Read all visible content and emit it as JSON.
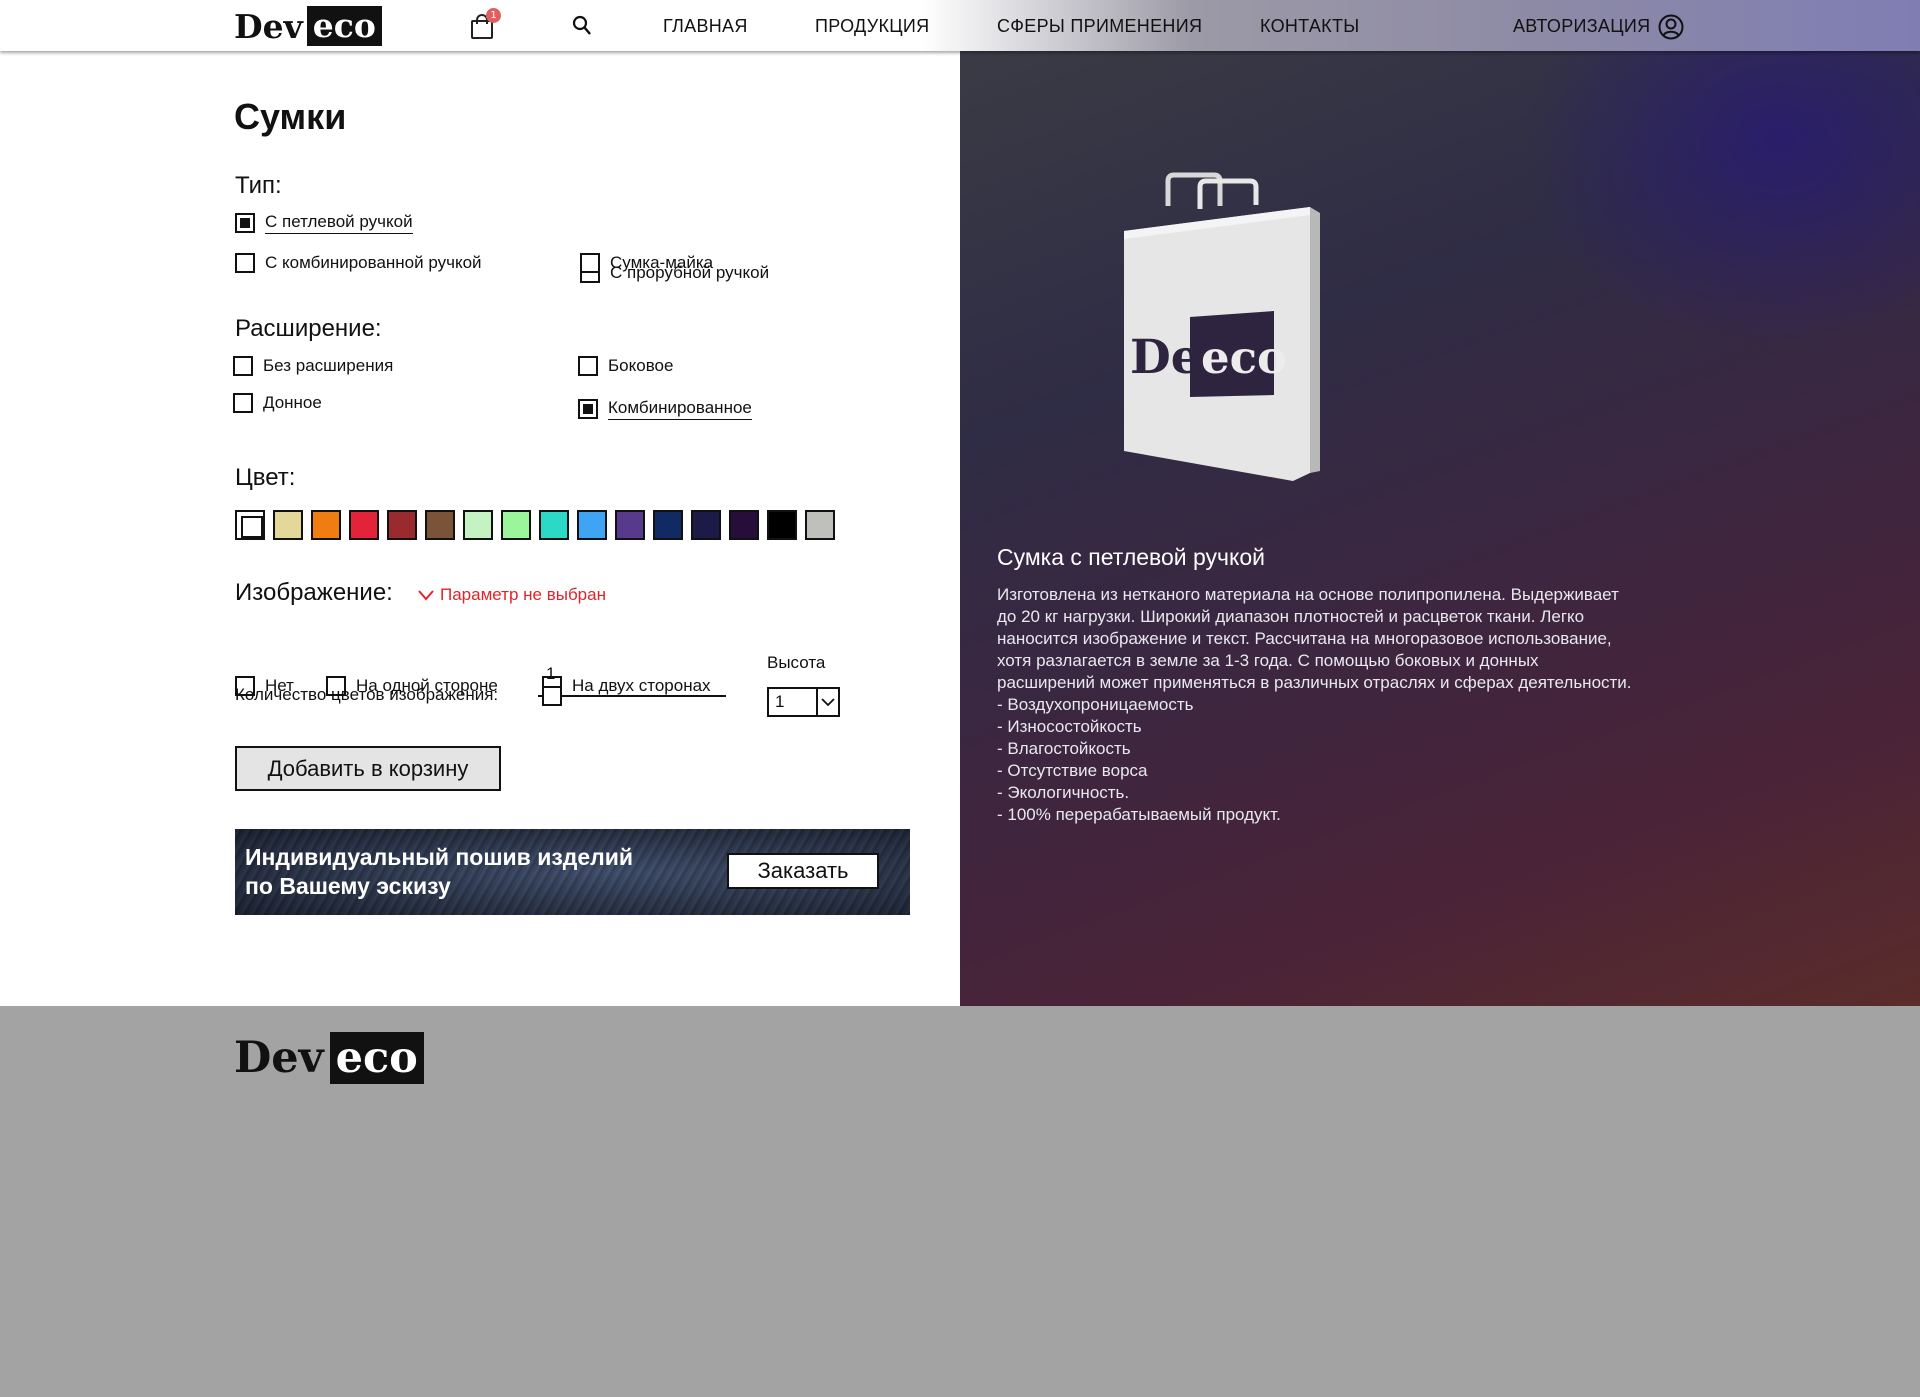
{
  "header": {
    "logo_dev": "Dev",
    "logo_eco": "eco",
    "cart_count": "1",
    "nav": [
      "ГЛАВНАЯ",
      "ПРОДУКЦИЯ",
      "СФЕРЫ ПРИМЕНЕНИЯ",
      "КОНТАКТЫ"
    ],
    "auth_label": "АВТОРИЗАЦИЯ"
  },
  "form": {
    "title": "Сумки",
    "type": {
      "label": "Тип:",
      "options": [
        "С петлевой ручкой",
        "С прорубной ручкой",
        "С комбинированной ручкой",
        "Сумка-майка"
      ],
      "selected": "С петлевой ручкой"
    },
    "expansion": {
      "label": "Расширение:",
      "options": [
        "Без расширения",
        "Боковое",
        "Донное",
        "Комбинированное"
      ],
      "selected": "Комбинированное"
    },
    "color": {
      "label": "Цвет:",
      "swatches": [
        "#ffffff",
        "#e3d79a",
        "#ef7d12",
        "#e2233a",
        "#992a2e",
        "#7a5339",
        "#c5f2c2",
        "#9af59b",
        "#2cd9c6",
        "#3fa4f4",
        "#583a8c",
        "#112a64",
        "#1c1a46",
        "#260d3a",
        "#000000",
        "#bfc0bc"
      ],
      "selected_index": 0
    },
    "image": {
      "label": "Изображение:",
      "warning": "Параметр не выбран",
      "options": [
        "Нет",
        "На одной стороне",
        "На двух сторонах"
      ]
    },
    "colors_count": {
      "label": "Количество цветов изображения:",
      "value": "1"
    },
    "height": {
      "label": "Высота",
      "value": "1"
    },
    "add_to_cart": "Добавить в корзину"
  },
  "banner": {
    "line1": "Индивидуальный пошив изделий",
    "line2": "по Вашему эскизу",
    "button": "Заказать"
  },
  "product": {
    "bag_logo_dev": "Dev",
    "bag_logo_eco": "eco",
    "title": "Сумка с петлевой ручкой",
    "description": "Изготовлена из нетканого материала на основе полипропилена. Выдерживает до 20 кг нагрузки. Широкий диапазон плотностей и расцветок ткани. Легко наносится изображение и текст. Рассчитана на многоразовое использование, хотя разлагается в земле за 1-3 года. С помощью боковых и донных расширений может применяться в различных отраслях и сферах деятельности.",
    "features": [
      "- Воздухопроницаемость",
      "- Износостойкость",
      "- Влагостойкость",
      "- Отсутствие ворса",
      "- Экологичность.",
      "- 100% перерабатываемый продукт."
    ]
  },
  "footer": {
    "logo_dev": "Dev",
    "logo_eco": "eco"
  },
  "colors": {
    "warning": "#e0242c",
    "footer_bg": "#a3a3a3"
  }
}
